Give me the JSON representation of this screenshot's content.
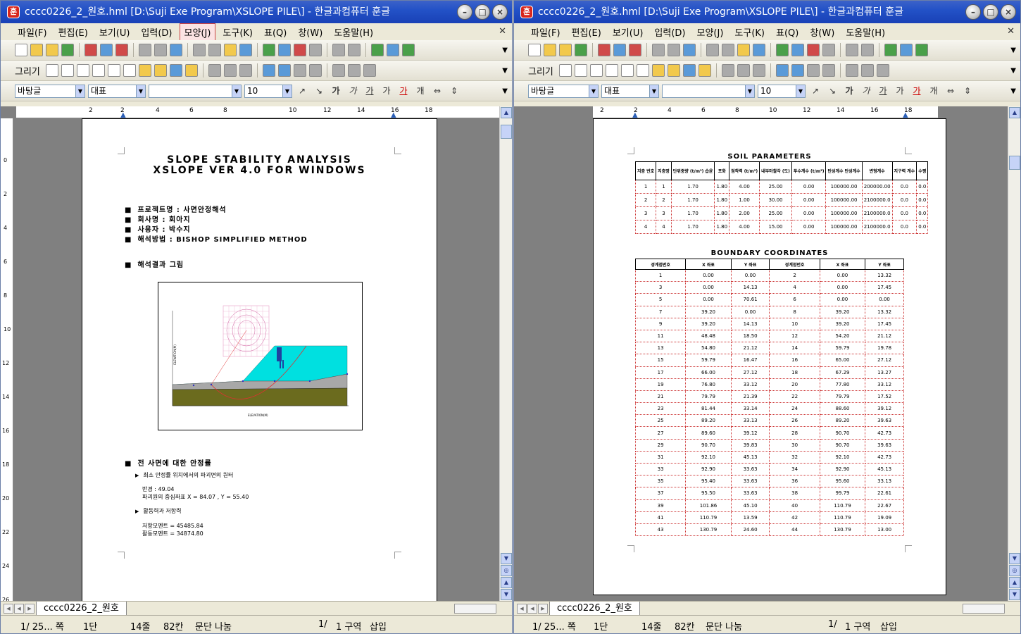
{
  "left_window": {
    "title": "cccc0226_2_원호.hml [D:\\Suji Exe Program\\XSLOPE PILE\\] - 한글과컴퓨터 훈글",
    "menu": [
      "파일(F)",
      "편집(E)",
      "보기(U)",
      "입력(D)",
      "모양(J)",
      "도구(K)",
      "표(Q)",
      "창(W)",
      "도움말(H)"
    ],
    "active_menu": "모양(J)",
    "draw_label": "그리기",
    "style_combo": "바탕글",
    "font_combo": "대표",
    "size_combo": "10",
    "format_buttons": [
      "가",
      "가",
      "가",
      "가",
      "가",
      "개"
    ],
    "ruler_h": [
      "2",
      "2",
      "4",
      "6",
      "8",
      "10",
      "12",
      "14",
      "16",
      "18"
    ],
    "ruler_v": [
      "2",
      "0",
      "2",
      "4",
      "6",
      "8",
      "10",
      "12",
      "14",
      "16",
      "18",
      "20",
      "22",
      "24",
      "26"
    ],
    "page": {
      "title1": "SLOPE STABILITY ANALYSIS",
      "title2": "XSLOPE VER 4.0 FOR WINDOWS",
      "info": [
        "프로젝트명 : 사면안정해석",
        "회사명 : 회아지",
        "사용자 : 박수지",
        "해석방법 : BISHOP SIMPLIFIED METHOD"
      ],
      "result_heading": "해석결과 그림",
      "chart_ylabel": "ELEVATION(M)",
      "chart_xlabel": "ELEVATION(M)",
      "chart_xticks": [
        "0",
        "10",
        "20",
        "30",
        "40",
        "50",
        "60",
        "70",
        "80",
        "90",
        "100",
        "110",
        "120",
        "130",
        "140",
        "150"
      ],
      "chart_yticks": [
        "70",
        "60",
        "50",
        "40",
        "30",
        "20",
        "10",
        "0"
      ],
      "safety_heading": "전 사면에 대한 안정률",
      "sub1": "최소 안정률 위치에서의 파괴면의 원터",
      "radius": "반경 : 49.04",
      "center": "파괴원의 중심좌표 X = 84.07 , Y = 55.40",
      "sub2": "활동력과 저항력",
      "resist": "저항모멘트 = 45485.84",
      "slide": "활동모멘트 = 34874.80"
    },
    "tab_label": "cccc0226_2_원호",
    "status": {
      "page": "1/ 25... 쪽",
      "column": "1단",
      "line": "14줄",
      "col": "82칸",
      "mode": "문단 나눔",
      "section_idx": "1/",
      "section": "1 구역",
      "insert": "삽입"
    }
  },
  "right_window": {
    "title": "cccc0226_2_원호.hml [D:\\Suji Exe Program\\XSLOPE PILE\\] - 한글과컴퓨터 훈글",
    "menu": [
      "파일(F)",
      "편집(E)",
      "보기(U)",
      "입력(D)",
      "모양(J)",
      "도구(K)",
      "표(Q)",
      "창(W)",
      "도움말(H)"
    ],
    "draw_label": "그리기",
    "style_combo": "바탕글",
    "font_combo": "대표",
    "size_combo": "10",
    "format_buttons": [
      "가",
      "가",
      "가",
      "가",
      "가",
      "개"
    ],
    "ruler_h": [
      "2",
      "2",
      "4",
      "6",
      "8",
      "10",
      "12",
      "14",
      "16",
      "18"
    ],
    "soil": {
      "title": "SOIL PARAMETERS",
      "headers": [
        "지층 번호",
        "지층명",
        "단위중량 (t/m³) 습윤",
        "포화",
        "점착력 (t/m²)",
        "내부마찰각 (도)",
        "투수계수 (t/m³)",
        "탄성계수 탄성계수",
        "변형계수",
        "지구력 계수",
        "수평"
      ],
      "rows": [
        [
          "1",
          "1",
          "1.70",
          "1.80",
          "4.00",
          "25.00",
          "0.00",
          "100000.00",
          "200000.00",
          "0.0",
          "0.0"
        ],
        [
          "2",
          "2",
          "1.70",
          "1.80",
          "1.00",
          "30.00",
          "0.00",
          "100000.00",
          "2100000.0",
          "0.0",
          "0.0"
        ],
        [
          "3",
          "3",
          "1.70",
          "1.80",
          "2.00",
          "25.00",
          "0.00",
          "100000.00",
          "2100000.0",
          "0.0",
          "0.0"
        ],
        [
          "4",
          "4",
          "1.70",
          "1.80",
          "4.00",
          "15.00",
          "0.00",
          "100000.00",
          "2100000.0",
          "0.0",
          "0.0"
        ]
      ]
    },
    "boundary": {
      "title": "BOUNDARY COORDINATES",
      "headers": [
        "경계점번호",
        "X 좌표",
        "Y 좌표",
        "경계점번호",
        "X 좌표",
        "Y 좌표"
      ],
      "rows": [
        [
          "1",
          "0.00",
          "0.00",
          "2",
          "0.00",
          "13.32"
        ],
        [
          "3",
          "0.00",
          "14.13",
          "4",
          "0.00",
          "17.45"
        ],
        [
          "5",
          "0.00",
          "70.61",
          "6",
          "0.00",
          "0.00"
        ],
        [
          "7",
          "39.20",
          "0.00",
          "8",
          "39.20",
          "13.32"
        ],
        [
          "9",
          "39.20",
          "14.13",
          "10",
          "39.20",
          "17.45"
        ],
        [
          "11",
          "48.48",
          "18.50",
          "12",
          "54.20",
          "21.12"
        ],
        [
          "13",
          "54.80",
          "21.12",
          "14",
          "59.79",
          "19.78"
        ],
        [
          "15",
          "59.79",
          "16.47",
          "16",
          "65.00",
          "27.12"
        ],
        [
          "17",
          "66.00",
          "27.12",
          "18",
          "67.29",
          "13.27"
        ],
        [
          "19",
          "76.80",
          "33.12",
          "20",
          "77.80",
          "33.12"
        ],
        [
          "21",
          "79.79",
          "21.39",
          "22",
          "79.79",
          "17.52"
        ],
        [
          "23",
          "81.44",
          "33.14",
          "24",
          "88.60",
          "39.12"
        ],
        [
          "25",
          "89.20",
          "33.13",
          "26",
          "89.20",
          "39.63"
        ],
        [
          "27",
          "89.60",
          "39.12",
          "28",
          "90.70",
          "42.73"
        ],
        [
          "29",
          "90.70",
          "39.83",
          "30",
          "90.70",
          "39.63"
        ],
        [
          "31",
          "92.10",
          "45.13",
          "32",
          "92.10",
          "42.73"
        ],
        [
          "33",
          "92.90",
          "33.63",
          "34",
          "92.90",
          "45.13"
        ],
        [
          "35",
          "95.40",
          "33.63",
          "36",
          "95.60",
          "33.13"
        ],
        [
          "37",
          "95.50",
          "33.63",
          "38",
          "99.79",
          "22.61"
        ],
        [
          "39",
          "101.86",
          "45.10",
          "40",
          "110.79",
          "22.67"
        ],
        [
          "41",
          "110.79",
          "13.59",
          "42",
          "110.79",
          "19.09"
        ],
        [
          "43",
          "130.79",
          "24.60",
          "44",
          "130.79",
          "13.00"
        ]
      ]
    },
    "tab_label": "cccc0226_2_원호",
    "status": {
      "page": "1/ 25... 쪽",
      "column": "1단",
      "line": "14줄",
      "col": "82칸",
      "mode": "문단 나눔",
      "section_idx": "1/",
      "section": "1 구역",
      "insert": "삽입"
    }
  }
}
